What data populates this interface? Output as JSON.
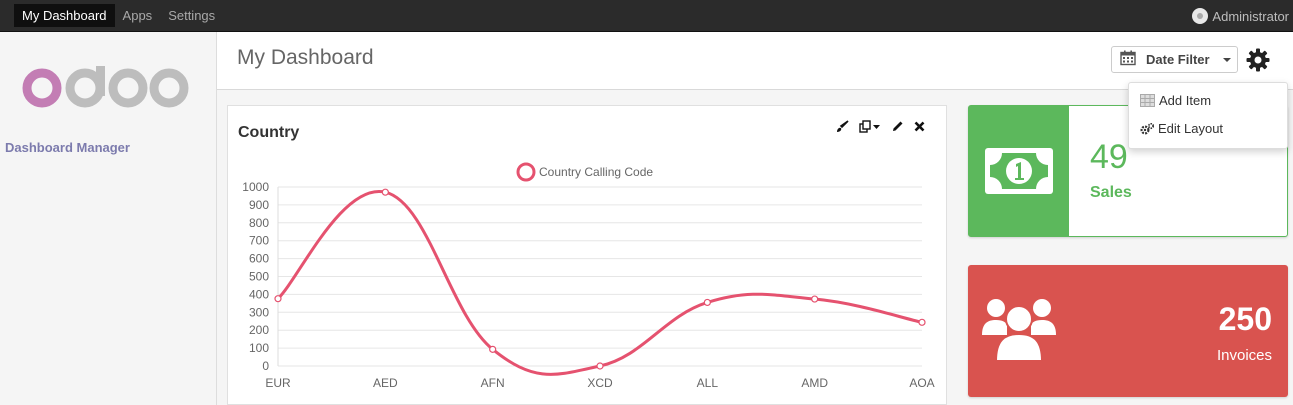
{
  "topbar": {
    "menu": [
      "My Dashboard",
      "Apps",
      "Settings"
    ],
    "user": "Administrator"
  },
  "sidebar": {
    "logo_text": "odoo",
    "nav_item": "Dashboard Manager"
  },
  "control": {
    "page_title": "My Dashboard",
    "date_filter_label": "Date Filter"
  },
  "dropdown": {
    "items": [
      "Add Item",
      "Edit Layout"
    ]
  },
  "chart_card": {
    "title": "Country"
  },
  "kpis": {
    "sales": {
      "value": "49",
      "label": "Sales",
      "color": "#5cb85c",
      "icon": "money-bill-icon"
    },
    "invoices": {
      "value": "250",
      "label": "Invoices",
      "color": "#d9534f",
      "icon": "users-icon"
    }
  },
  "chart_data": {
    "type": "line",
    "title": "",
    "xlabel": "",
    "ylabel": "",
    "categories": [
      "EUR",
      "AED",
      "AFN",
      "XCD",
      "ALL",
      "AMD",
      "AOA"
    ],
    "series": [
      {
        "name": "Country Calling Code",
        "values": [
          376,
          971,
          93,
          0,
          355,
          374,
          244
        ],
        "color": "#e5526f"
      }
    ],
    "ylim": [
      0,
      1000
    ],
    "yticks": [
      0,
      100,
      200,
      300,
      400,
      500,
      600,
      700,
      800,
      900,
      1000
    ],
    "grid": true,
    "legend": "top-center"
  }
}
